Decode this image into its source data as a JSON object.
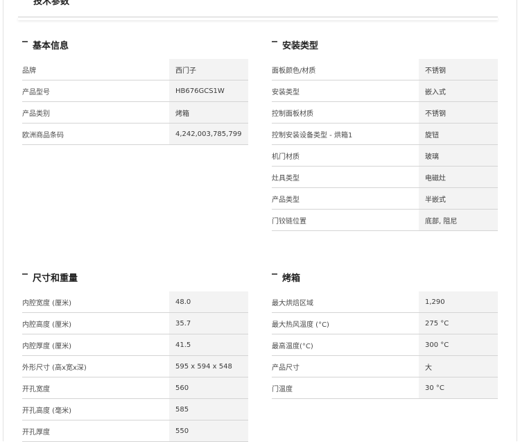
{
  "page_title": "技术参数",
  "sections": [
    {
      "title": "基本信息",
      "rows": [
        {
          "label": "品牌",
          "value": "西门子"
        },
        {
          "label": "产品型号",
          "value": "HB676GCS1W"
        },
        {
          "label": "产品类别",
          "value": "烤箱"
        },
        {
          "label": "欧洲商品条码",
          "value": "4,242,003,785,799"
        }
      ]
    },
    {
      "title": "安装类型",
      "rows": [
        {
          "label": "面板颜色/材质",
          "value": "不锈钢"
        },
        {
          "label": "安装类型",
          "value": "嵌入式"
        },
        {
          "label": "控制面板材质",
          "value": "不锈钢"
        },
        {
          "label": "控制安装设备类型 - 烘箱1",
          "value": "旋钮"
        },
        {
          "label": "机门材质",
          "value": "玻璃"
        },
        {
          "label": "灶具类型",
          "value": "电磁灶"
        },
        {
          "label": "产品类型",
          "value": "半嵌式"
        },
        {
          "label": "门铰链位置",
          "value": "底部, 阻尼"
        }
      ]
    },
    {
      "title": "尺寸和重量",
      "rows": [
        {
          "label": "内腔宽度 (厘米)",
          "value": "48.0"
        },
        {
          "label": "内腔高度 (厘米)",
          "value": "35.7"
        },
        {
          "label": "内腔厚度 (厘米)",
          "value": "41.5"
        },
        {
          "label": "外形尺寸 (高x宽x深)",
          "value": "595 x 594 x 548"
        },
        {
          "label": "开孔宽度",
          "value": "560"
        },
        {
          "label": "开孔高度 (毫米)",
          "value": "585"
        },
        {
          "label": "开孔厚度",
          "value": "550"
        }
      ]
    },
    {
      "title": "烤箱",
      "rows": [
        {
          "label": "最大烘焙区域",
          "value": "1,290"
        },
        {
          "label": "最大热风温度 (°C)",
          "value": "275 °C"
        },
        {
          "label": "最高温度(°C)",
          "value": "300 °C"
        },
        {
          "label": "产品尺寸",
          "value": "大"
        },
        {
          "label": "门温度",
          "value": "30 °C"
        }
      ]
    }
  ]
}
